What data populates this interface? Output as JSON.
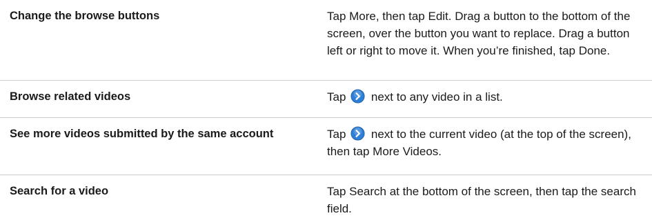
{
  "rows": [
    {
      "task": "Change the browse buttons",
      "desc_before": "Tap More, then tap Edit. Drag a button to the bottom of the screen, over the button you want to replace. Drag a button left or right to move it. When you’re finished, tap Done.",
      "desc_after": ""
    },
    {
      "task": "Browse related videos",
      "desc_before": "Tap",
      "desc_after": "next to any video in a list."
    },
    {
      "task": "See more videos submitted by the same account",
      "desc_before": "Tap",
      "desc_after": "next to the current video (at the top of the screen), then tap More Videos."
    },
    {
      "task": "Search for a video",
      "desc_before": "Tap Search at the bottom of the screen, then tap the search field.",
      "desc_after": ""
    }
  ],
  "icon": {
    "name": "disclosure-arrow-icon",
    "color_outer": "#2e7fd6",
    "color_inner": "#ffffff"
  }
}
